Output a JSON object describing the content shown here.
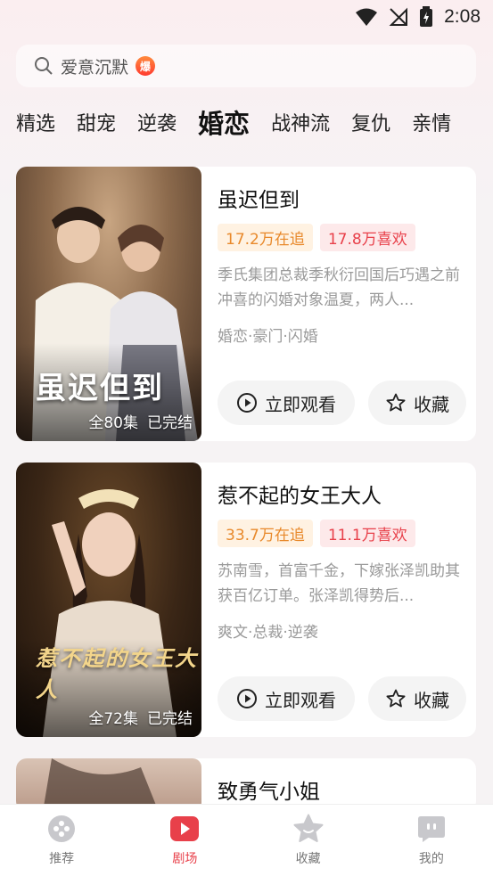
{
  "status_bar": {
    "time": "2:08"
  },
  "search": {
    "text": "爱意沉默",
    "hot_badge": "爆"
  },
  "category_tabs": [
    {
      "label": "精选"
    },
    {
      "label": "甜宠"
    },
    {
      "label": "逆袭"
    },
    {
      "label": "婚恋",
      "active": true
    },
    {
      "label": "战神流"
    },
    {
      "label": "复仇"
    },
    {
      "label": "亲情"
    }
  ],
  "dramas": [
    {
      "title": "虽迟但到",
      "poster_title": "虽迟但到",
      "episodes": "全80集",
      "status": "已完结",
      "followers": "17.2万在追",
      "likes": "17.8万喜欢",
      "description": "季氏集团总裁季秋衍回国后巧遇之前冲喜的闪婚对象温夏，两人...",
      "tags": "婚恋·豪门·闪婚",
      "watch_label": "立即观看",
      "fav_label": "收藏"
    },
    {
      "title": "惹不起的女王大人",
      "poster_title": "惹不起的女王大人",
      "episodes": "全72集",
      "status": "已完结",
      "followers": "33.7万在追",
      "likes": "11.1万喜欢",
      "description": "苏南雪，首富千金，下嫁张泽凯助其获百亿订单。张泽凯得势后...",
      "tags": "爽文·总裁·逆袭",
      "watch_label": "立即观看",
      "fav_label": "收藏"
    },
    {
      "title": "致勇气小姐"
    }
  ],
  "bottom_nav": [
    {
      "label": "推荐",
      "icon": "recommend-icon"
    },
    {
      "label": "剧场",
      "icon": "theater-icon",
      "active": true
    },
    {
      "label": "收藏",
      "icon": "star-icon"
    },
    {
      "label": "我的",
      "icon": "profile-icon"
    }
  ],
  "colors": {
    "accent": "#e8404a",
    "follow_text": "#e8892b"
  }
}
